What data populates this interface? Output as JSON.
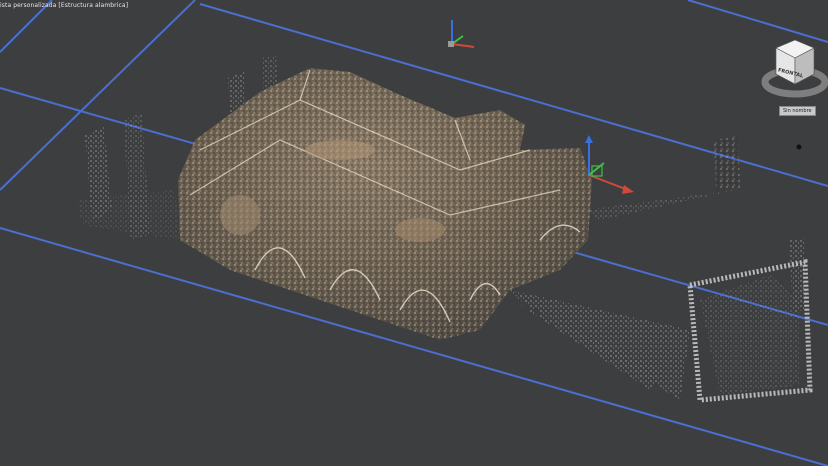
{
  "viewport": {
    "label": "ista personalizada [Estructura alambrica]"
  },
  "viewcube": {
    "face_label": "FRONTAL",
    "face_color": "#e6e6e6",
    "ring_color": "#8a8a8a"
  },
  "view_menu": {
    "label": "Sin nombre"
  },
  "colors": {
    "background": "#3d3e40",
    "grid_lines": "#4a6fd0",
    "axis_x": "#d04a3a",
    "axis_y": "#3fbf4a",
    "axis_z": "#3a6fe0"
  },
  "icons": {
    "ucs": "ucs-axis-icon",
    "gizmo": "move-gizmo-icon",
    "viewcube": "viewcube-icon",
    "nav": "navigation-dot-icon"
  }
}
